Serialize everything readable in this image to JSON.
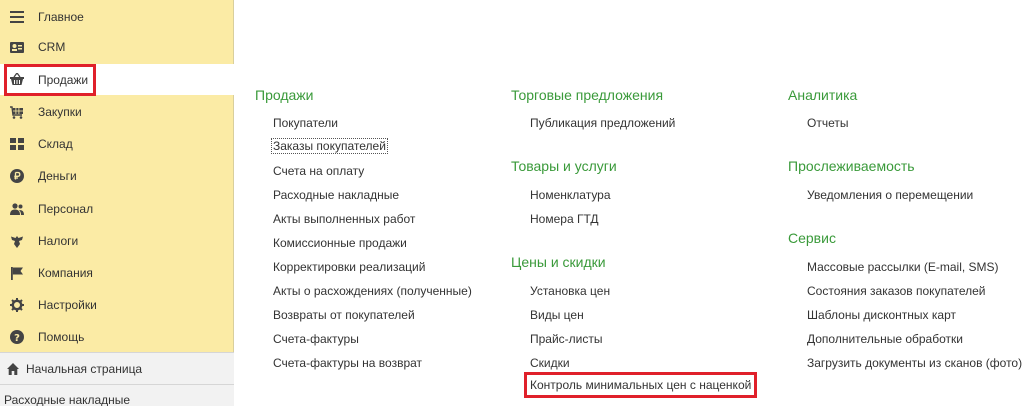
{
  "sidebar": {
    "items": [
      {
        "label": "Главное",
        "icon": "menu-icon"
      },
      {
        "label": "CRM",
        "icon": "contact-card-icon"
      },
      {
        "label": "Продажи",
        "icon": "shopping-basket-icon",
        "active": true
      },
      {
        "label": "Закупки",
        "icon": "cart-grid-icon"
      },
      {
        "label": "Склад",
        "icon": "warehouse-icon"
      },
      {
        "label": "Деньги",
        "icon": "ruble-coin-icon"
      },
      {
        "label": "Персонал",
        "icon": "people-icon"
      },
      {
        "label": "Налоги",
        "icon": "eagle-emblem-icon"
      },
      {
        "label": "Компания",
        "icon": "flag-icon"
      },
      {
        "label": "Настройки",
        "icon": "gear-icon"
      },
      {
        "label": "Помощь",
        "icon": "help-icon"
      }
    ],
    "home_label": "Начальная страница",
    "open_tab_label": "Расходные накладные"
  },
  "sections": {
    "sales": {
      "title": "Продажи",
      "links": [
        "Покупатели",
        "Заказы покупателей",
        "Счета на оплату",
        "Расходные накладные",
        "Акты выполненных работ",
        "Комиссионные продажи",
        "Корректировки реализаций",
        "Акты о расхождениях (полученные)",
        "Возвраты от покупателей",
        "Счета-фактуры",
        "Счета-фактуры на возврат"
      ]
    },
    "trade_offers": {
      "title": "Торговые предложения",
      "links": [
        "Публикация предложений"
      ]
    },
    "goods_services": {
      "title": "Товары и услуги",
      "links": [
        "Номенклатура",
        "Номера ГТД"
      ]
    },
    "prices_discounts": {
      "title": "Цены и скидки",
      "links": [
        "Установка цен",
        "Виды цен",
        "Прайс-листы",
        "Скидки",
        "Контроль минимальных цен с наценкой"
      ]
    },
    "analytics": {
      "title": "Аналитика",
      "links": [
        "Отчеты"
      ]
    },
    "traceability": {
      "title": "Прослеживаемость",
      "links": [
        "Уведомления о перемещении"
      ]
    },
    "service": {
      "title": "Сервис",
      "links": [
        "Массовые рассылки (E-mail, SMS)",
        "Состояния заказов покупателей",
        "Шаблоны дисконтных карт",
        "Дополнительные обработки",
        "Загрузить документы из сканов (фото)"
      ]
    }
  },
  "colors": {
    "sidebar_bg": "#fbeba5",
    "section_title": "#3a9a3a",
    "highlight": "#e0202a"
  }
}
